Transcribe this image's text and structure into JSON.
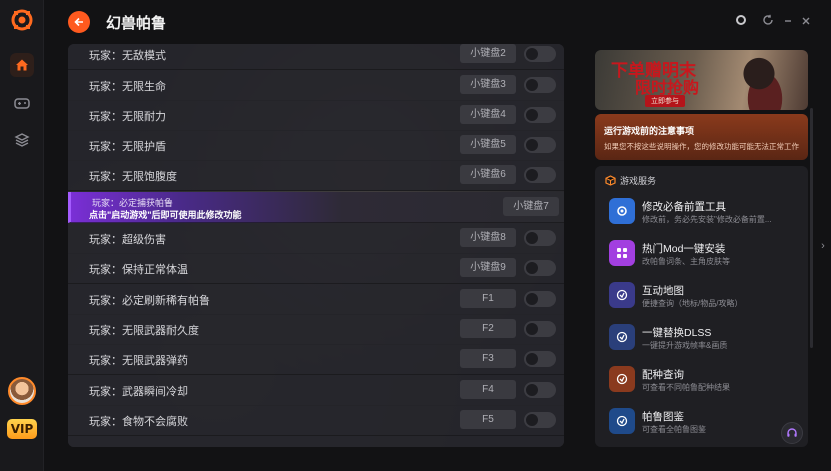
{
  "app": {
    "title": "幻兽帕鲁"
  },
  "sidebar": {
    "vip_label": "VIP"
  },
  "cheats": [
    {
      "label": "玩家：无敌模式",
      "key": "小键盘2"
    },
    {
      "label": "玩家：无限生命",
      "key": "小键盘3"
    },
    {
      "label": "玩家：无限耐力",
      "key": "小键盘4"
    },
    {
      "label": "玩家：无限护盾",
      "key": "小键盘5"
    },
    {
      "label": "玩家：无限饱腹度",
      "key": "小键盘6"
    },
    {
      "label": "玩家：必定捕获帕鲁",
      "sublabel": "点击\"启动游戏\"后即可使用此修改功能",
      "key": "小键盘7",
      "highlight": true
    },
    {
      "label": "玩家：超级伤害",
      "key": "小键盘8"
    },
    {
      "label": "玩家：保持正常体温",
      "key": "小键盘9"
    },
    {
      "label": "玩家：必定刷新稀有帕鲁",
      "key": "F1"
    },
    {
      "label": "玩家：无限武器耐久度",
      "key": "F2"
    },
    {
      "label": "玩家：无限武器弹药",
      "key": "F3"
    },
    {
      "label": "玩家：武器瞬间冷却",
      "key": "F4"
    },
    {
      "label": "玩家：食物不会腐败",
      "key": "F5"
    }
  ],
  "banner": {
    "line1": "下单赠明末",
    "line2": "限时抢购",
    "tag": "立即参与"
  },
  "notice": {
    "title": "运行游戏前的注意事项",
    "desc": "如果您不按这些说明操作，您的修改功能可能无法正常工作"
  },
  "services": {
    "header": "游戏服务",
    "items": [
      {
        "title": "修改必备前置工具",
        "desc": "修改前，务必先安装\"修改必备前置...",
        "color": "#2f6fd6",
        "icon": "wrench-icon"
      },
      {
        "title": "热门Mod一键安装",
        "desc": "改帕鲁词条、主角皮肤等",
        "color": "#a23fe0",
        "icon": "mod-icon"
      },
      {
        "title": "互动地图",
        "desc": "便捷查询（地标/物品/攻略）",
        "color": "#3a3a8a",
        "icon": "map-icon"
      },
      {
        "title": "一键替换DLSS",
        "desc": "一键提升游戏帧率&画质",
        "color": "#2a3f7a",
        "icon": "dlss-icon"
      },
      {
        "title": "配种查询",
        "desc": "可查看不同帕鲁配种结果",
        "color": "#8a3a1e",
        "icon": "breed-icon"
      },
      {
        "title": "帕鲁图鉴",
        "desc": "可查看全帕鲁图鉴",
        "color": "#1f4a8a",
        "icon": "book-icon"
      }
    ]
  },
  "colors": {
    "accent": "#ff5a1f",
    "highlight": "#7a2fd6",
    "vip": "#ffb31a"
  }
}
